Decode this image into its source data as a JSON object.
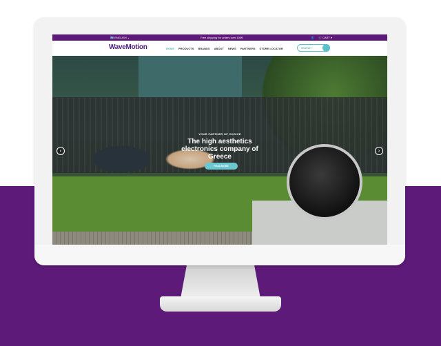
{
  "topbar": {
    "language": "ENGLISH",
    "promo": "Free shipping for orders over 100€",
    "cart": "CART"
  },
  "nav": {
    "logo": "WaveMotion",
    "items": [
      "HOME",
      "PRODUCTS",
      "BRANDS",
      "ABOUT",
      "NEWS",
      "PARTNERS",
      "STORE LOCATOR"
    ],
    "search_placeholder": "SEARCH"
  },
  "hero": {
    "kicker": "YOUR PARTNER OF CHOICE",
    "title": "The high aesthetics electronics company of Greece",
    "button": "READ MORE"
  },
  "colors": {
    "brand": "#5d1a78",
    "accent": "#5bc0c8"
  }
}
